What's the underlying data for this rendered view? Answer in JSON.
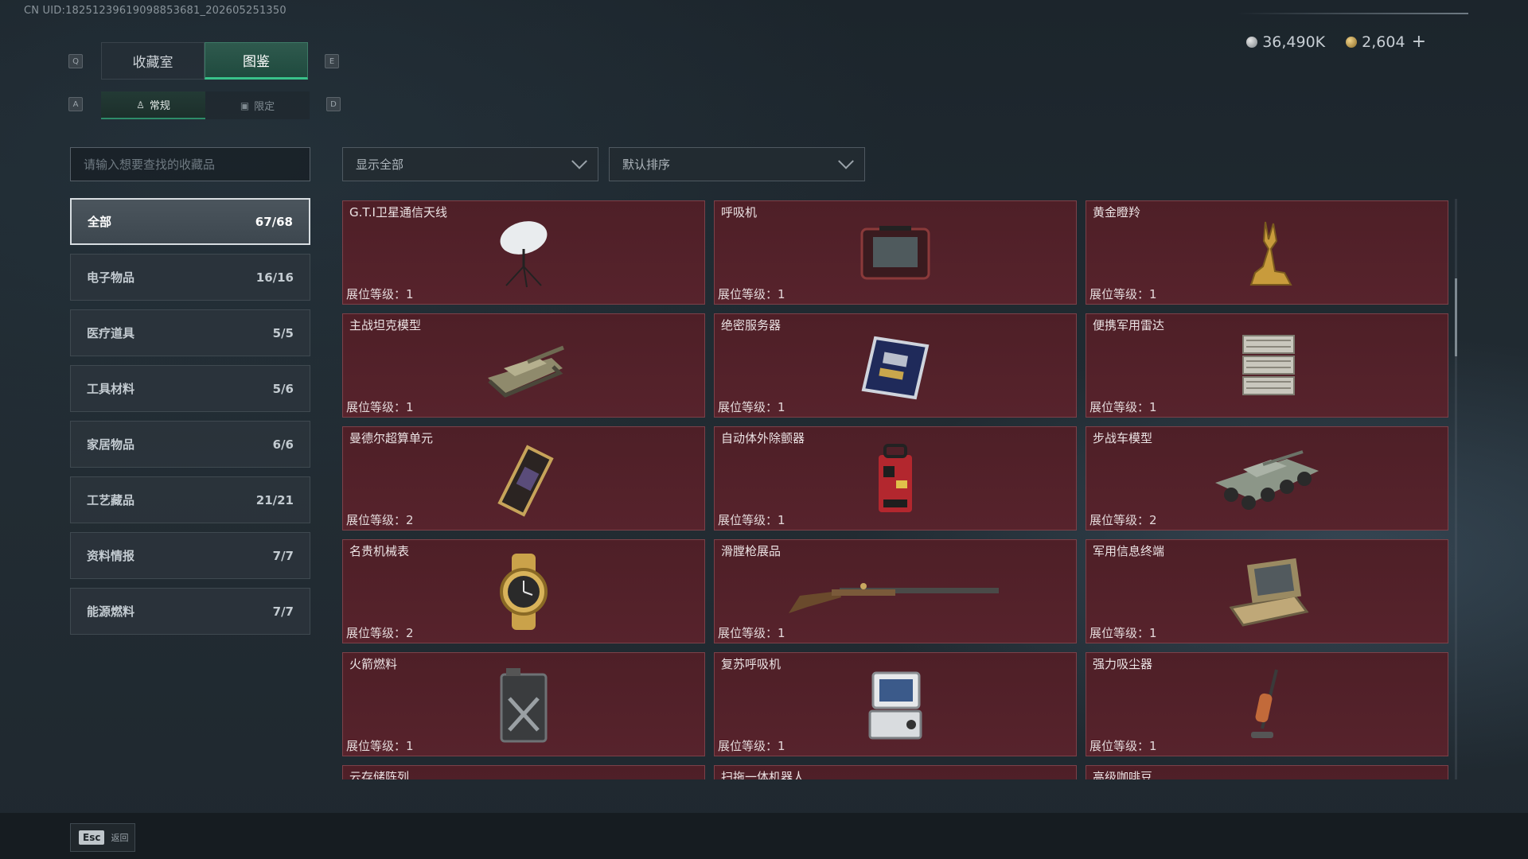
{
  "uid_text": "CN UID:18251239619098853681_202605251350",
  "currency": {
    "silver": "36,490K",
    "gold": "2,604",
    "plus": "+"
  },
  "keys": {
    "q": "Q",
    "e": "E",
    "a": "A",
    "d": "D"
  },
  "tabs": [
    {
      "label": "收藏室",
      "active": false
    },
    {
      "label": "图鉴",
      "active": true
    }
  ],
  "subtabs": [
    {
      "label": "常规",
      "active": true
    },
    {
      "label": "限定",
      "active": false
    }
  ],
  "search": {
    "placeholder": "请输入想要查找的收藏品"
  },
  "filters": {
    "show": "显示全部",
    "sort": "默认排序"
  },
  "categories": [
    {
      "label": "全部",
      "count": "67/68",
      "active": true
    },
    {
      "label": "电子物品",
      "count": "16/16"
    },
    {
      "label": "医疗道具",
      "count": "5/5"
    },
    {
      "label": "工具材料",
      "count": "5/6"
    },
    {
      "label": "家居物品",
      "count": "6/6"
    },
    {
      "label": "工艺藏品",
      "count": "21/21"
    },
    {
      "label": "资料情报",
      "count": "7/7"
    },
    {
      "label": "能源燃料",
      "count": "7/7"
    }
  ],
  "level_prefix": "展位等级：",
  "items": [
    {
      "name": "G.T.I卫星通信天线",
      "level": "1",
      "icon": "satellite-dish-icon"
    },
    {
      "name": "呼吸机",
      "level": "1",
      "icon": "ventilator-icon"
    },
    {
      "name": "黄金瞪羚",
      "level": "1",
      "icon": "golden-gazelle-icon"
    },
    {
      "name": "主战坦克模型",
      "level": "1",
      "icon": "tank-model-icon"
    },
    {
      "name": "绝密服务器",
      "level": "1",
      "icon": "server-icon"
    },
    {
      "name": "便携军用雷达",
      "level": "1",
      "icon": "radar-icon"
    },
    {
      "name": "曼德尔超算单元",
      "level": "2",
      "icon": "compute-unit-icon"
    },
    {
      "name": "自动体外除颤器",
      "level": "1",
      "icon": "defibrillator-icon"
    },
    {
      "name": "步战车模型",
      "level": "2",
      "icon": "ifv-model-icon"
    },
    {
      "name": "名贵机械表",
      "level": "2",
      "icon": "watch-icon"
    },
    {
      "name": "滑膛枪展品",
      "level": "1",
      "icon": "musket-icon"
    },
    {
      "name": "军用信息终端",
      "level": "1",
      "icon": "terminal-icon"
    },
    {
      "name": "火箭燃料",
      "level": "1",
      "icon": "fuel-can-icon"
    },
    {
      "name": "复苏呼吸机",
      "level": "1",
      "icon": "resuscitator-icon"
    },
    {
      "name": "强力吸尘器",
      "level": "1",
      "icon": "vacuum-icon"
    },
    {
      "name": "云存储阵列",
      "level": "",
      "icon": "storage-array-icon"
    },
    {
      "name": "扫拖一体机器人",
      "level": "",
      "icon": "robot-vacuum-icon"
    },
    {
      "name": "高级咖啡豆",
      "level": "",
      "icon": "coffee-beans-icon"
    }
  ],
  "footer": {
    "esc_key": "Esc",
    "esc_label": "返回"
  },
  "colors": {
    "accent": "#39c28a",
    "card_bg": "#57232c",
    "card_border": "#7c4149"
  }
}
